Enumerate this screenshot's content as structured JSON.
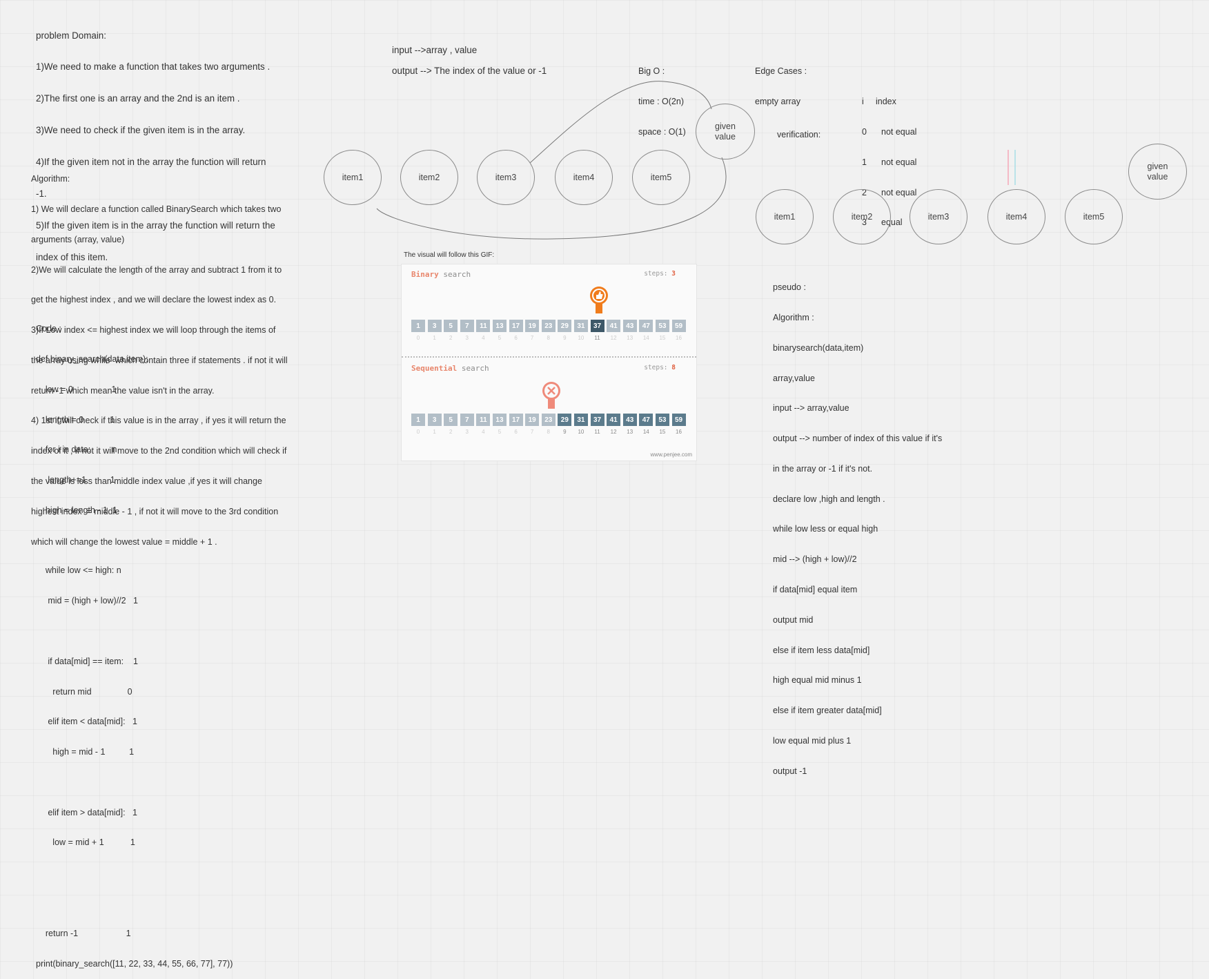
{
  "problem_domain": {
    "lines": [
      "problem Domain:",
      "1)We need to make a function that takes two arguments .",
      "2)The first one is an array and the 2nd is an item .",
      "3)We need to check if the given item is in the array.",
      "4)If the given item not in the array the function will return",
      "-1.",
      "5)If the given item is in the array the function will return the",
      "index of this item."
    ]
  },
  "io": {
    "input": "input -->array , value",
    "output": "output --> The index of the value or -1"
  },
  "big_o": {
    "lines": [
      "Big O :",
      "time : O(2n)",
      "space : O(1)"
    ]
  },
  "edge_cases": {
    "lines": [
      "Edge Cases :",
      "empty array"
    ]
  },
  "index_table": {
    "header": [
      "i",
      "index"
    ],
    "rows": [
      [
        "0",
        "not equal"
      ],
      [
        "1",
        "not equal"
      ],
      [
        "2",
        "not equal"
      ],
      [
        "3",
        "equal"
      ]
    ]
  },
  "verification_label": "verification:",
  "algorithm": {
    "lines": [
      "Algorithm:",
      "1) We will declare a function called BinarySearch which takes two",
      "arguments (array, value)",
      "2)We will calculate the length of the array and subtract 1 from it to",
      "get the highest index , and we will declare the lowest index as 0.",
      "3)If Low index <= highest index we will loop through the items of",
      "the array using while  which contain three if statements . if not it will",
      "return -1 which mean the value isn't in the array.",
      "4) 1st if will check if this value is in the array , if yes it will return the",
      "index of it , if not it will move to the 2nd condition which will check if",
      "the value is less than middle index value ,if yes it will change",
      "highest index  = middle - 1 , if not it will move to the 3rd condition",
      "which will change the lowest value = middle + 1 ."
    ]
  },
  "code": {
    "lines": [
      "Code :",
      "def binary_search(data,item):",
      "    low = 0                1",
      "    length = 0           1",
      "    for i in data:         n",
      "     length+=1          1",
      "    high = length - 1  1",
      "",
      "    while low <= high: n",
      "     mid = (high + low)//2   1",
      "",
      "     if data[mid] == item:    1",
      "       return mid               0",
      "     elif item < data[mid]:   1",
      "       high = mid - 1          1",
      "",
      "     elif item > data[mid]:   1",
      "       low = mid + 1           1",
      "",
      "",
      "    return -1                    1",
      "print(binary_search([11, 22, 33, 44, 55, 66, 77], 77))"
    ]
  },
  "pseudo": {
    "lines": [
      "pseudo :",
      "Algorithm :",
      "binarysearch(data,item)",
      "array,value",
      "input --> array,value",
      "output --> number of index of this value if it's",
      "in the array or -1 if it's not.",
      "declare low ,high and length .",
      "while low less or equal high",
      "mid --> (high + low)//2",
      "if data[mid] equal item",
      "output mid",
      "else if item less data[mid]",
      "high equal mid minus 1",
      "else if item greater data[mid]",
      "low equal mid plus 1",
      "output -1"
    ]
  },
  "diagram_left": {
    "items": [
      "item1",
      "item2",
      "item3",
      "item4",
      "item5"
    ],
    "given_value": "given\nvalue"
  },
  "diagram_right": {
    "items": [
      "item1",
      "item2",
      "item3",
      "item4",
      "item5"
    ],
    "given_value": "given\nvalue"
  },
  "gif": {
    "caption": "The visual will follow this GIF:",
    "binary_title_a": "Binary",
    "binary_title_b": "search",
    "binary_steps_label": "steps:",
    "binary_steps_value": "3",
    "sequential_title_a": "Sequential",
    "sequential_title_b": "search",
    "sequential_steps_label": "steps:",
    "sequential_steps_value": "8",
    "numbers": [
      "1",
      "3",
      "5",
      "7",
      "11",
      "13",
      "17",
      "19",
      "23",
      "29",
      "31",
      "37",
      "41",
      "43",
      "47",
      "53",
      "59"
    ],
    "indices": [
      "0",
      "1",
      "2",
      "3",
      "4",
      "5",
      "6",
      "7",
      "8",
      "9",
      "10",
      "11",
      "12",
      "13",
      "14",
      "15",
      "16"
    ],
    "binary_found_index": 11,
    "sequential_current_index": 8,
    "footer": "www.penjee.com",
    "colors": {
      "faded": "#b2bec7",
      "active": "#5b7b8c",
      "found": "#3e5868",
      "marker_good": "#f07c1c",
      "marker_bad": "#ef8a7a"
    },
    "icons": [
      "thumbs-up-icon",
      "x-mark-icon"
    ]
  },
  "accent_colors": {
    "pink_line": "#f4a8b8",
    "cyan_line": "#a8dde6"
  }
}
